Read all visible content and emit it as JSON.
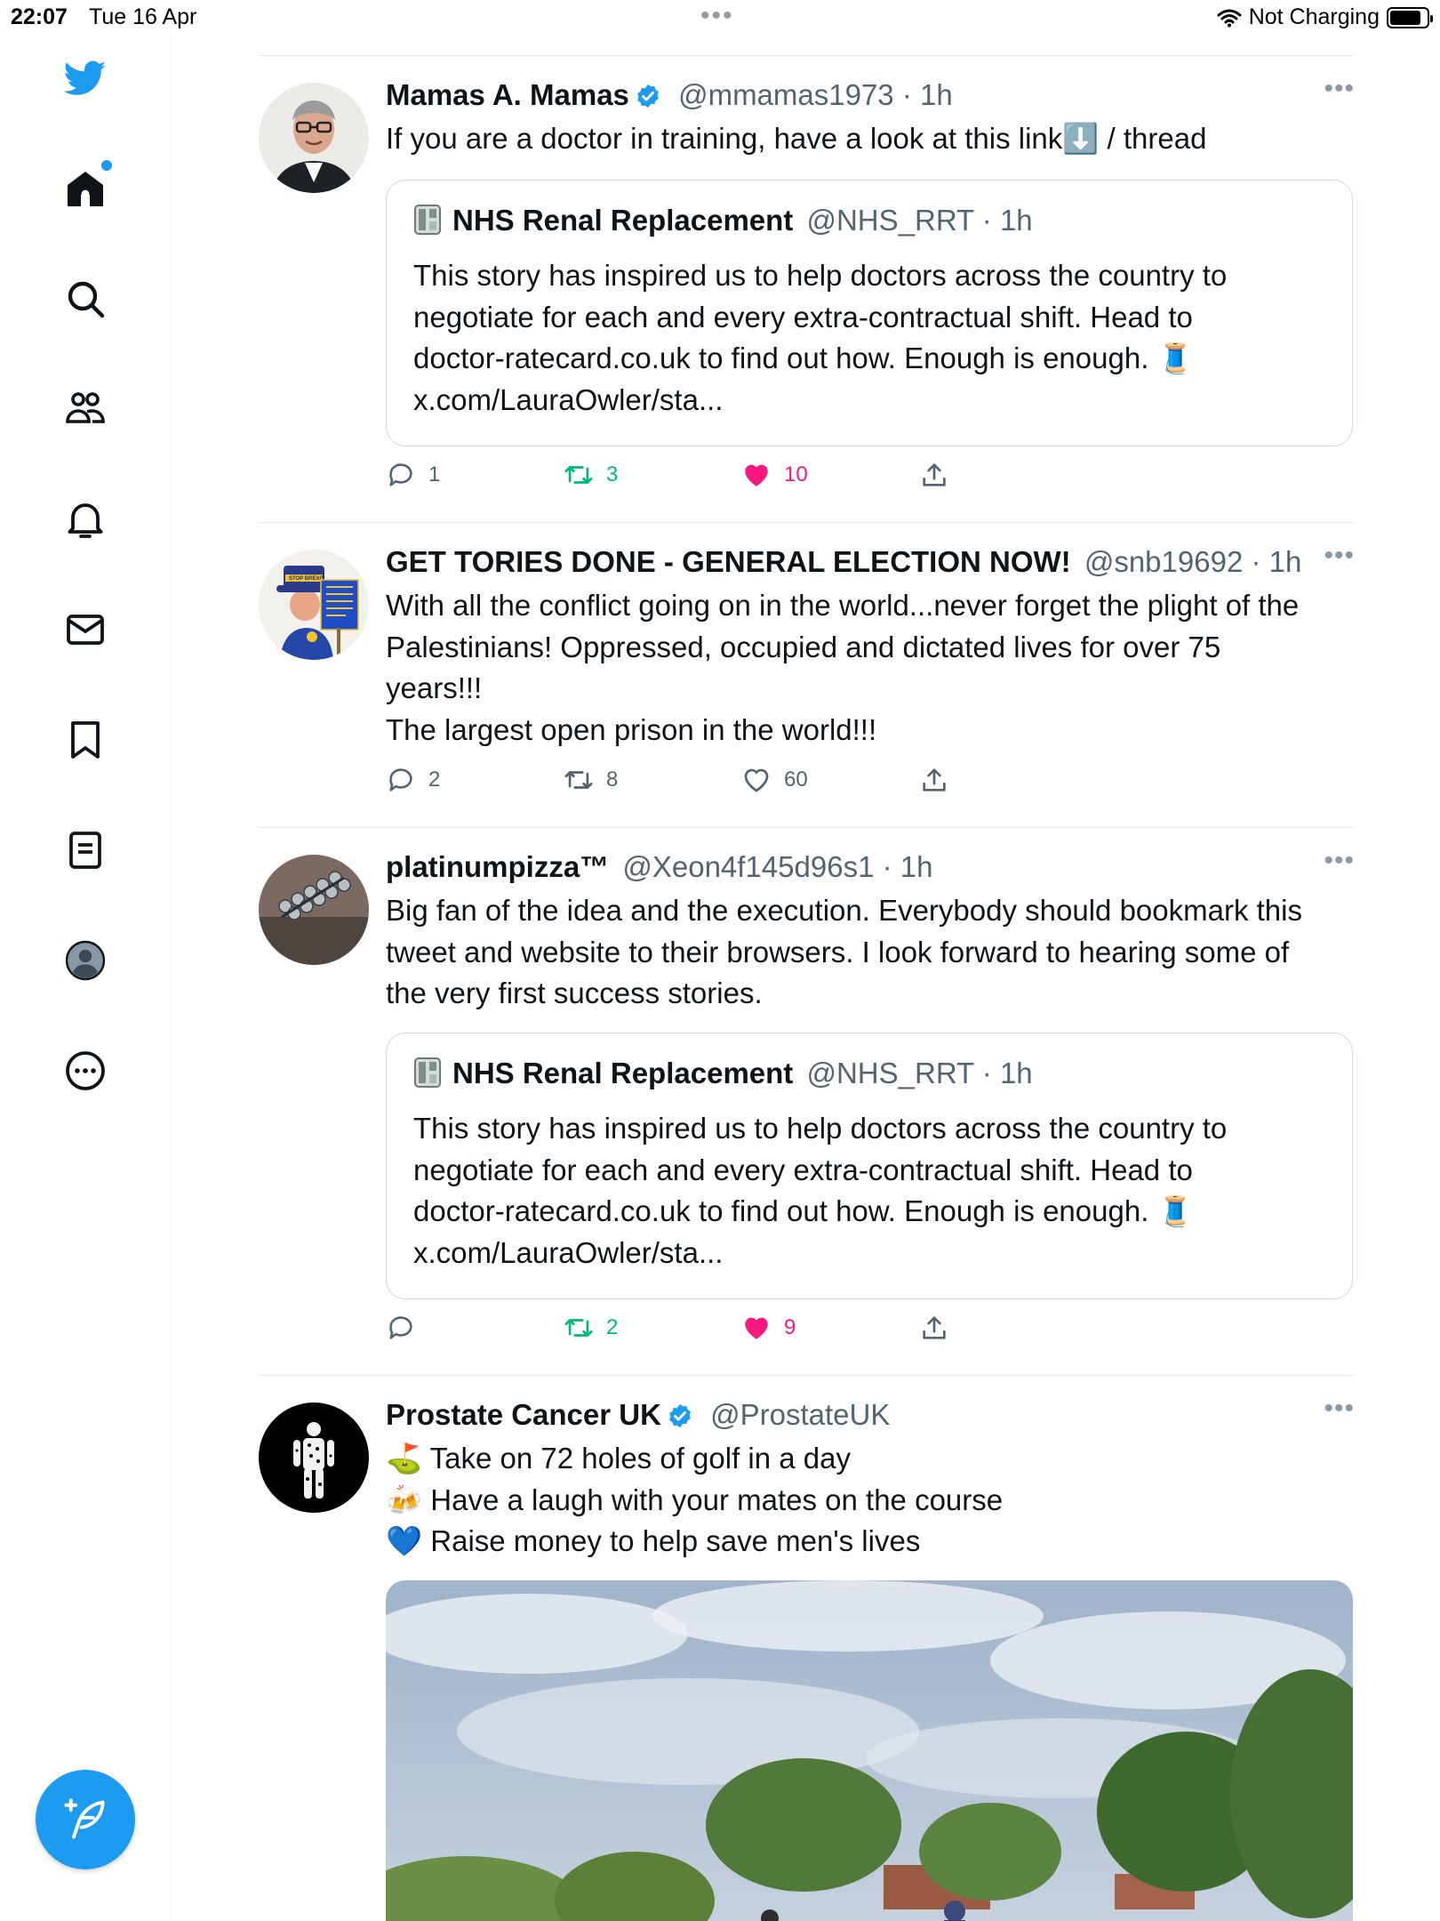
{
  "status_bar": {
    "time": "22:07",
    "date": "Tue 16 Apr",
    "battery_text": "Not Charging"
  },
  "colors": {
    "accent": "#1d9bf0",
    "retweet_active": "#00ba7c",
    "like_active": "#f91880",
    "secondary_text": "#536471"
  },
  "sidebar": {
    "items": [
      {
        "icon": "twitter-bird-icon"
      },
      {
        "icon": "home-icon",
        "notification_dot": true
      },
      {
        "icon": "search-icon"
      },
      {
        "icon": "communities-icon"
      },
      {
        "icon": "bell-icon"
      },
      {
        "icon": "mail-icon"
      },
      {
        "icon": "bookmark-icon"
      },
      {
        "icon": "lists-icon"
      },
      {
        "icon": "profile-icon"
      },
      {
        "icon": "more-circle-icon"
      }
    ],
    "compose_icon": "compose-feather-icon"
  },
  "tweets": [
    {
      "name": "Mamas A. Mamas",
      "verified": true,
      "handle": "@mmamas1973 · 1h",
      "text": "If you are a doctor in training, have a look at this link⬇️ / thread",
      "quote": {
        "name": "NHS Renal Replacement",
        "handle": "@NHS_RRT · 1h",
        "text": "This story has inspired us to help doctors across the country to\nnegotiate for each and every extra-contractual shift. Head to\ndoctor-ratecard.co.uk to find out how. Enough is enough. 🧵\nx.com/LauraOwler/sta..."
      },
      "replies": "1",
      "retweets": "3",
      "likes": "10",
      "retweeted": true,
      "liked": true
    },
    {
      "name": "GET TORIES DONE - GENERAL ELECTION NOW!",
      "verified": false,
      "handle": "@snb19692 · 1h",
      "text": "With all the conflict going on in the world...never forget the plight of the\nPalestinians! Oppressed, occupied and dictated lives for over 75\nyears!!!\nThe largest open prison in the world!!!",
      "replies": "2",
      "retweets": "8",
      "likes": "60",
      "retweeted": false,
      "liked": false
    },
    {
      "name": "platinumpizza™",
      "verified": false,
      "handle": "@Xeon4f145d96s1 · 1h",
      "text": "Big fan of the idea and the execution. Everybody should bookmark this\ntweet and website to their browsers. I look forward to hearing some of\nthe very first success stories.",
      "quote": {
        "name": "NHS Renal Replacement",
        "handle": "@NHS_RRT · 1h",
        "text": "This story has inspired us to help doctors across the country to\nnegotiate for each and every extra-contractual shift. Head to\ndoctor-ratecard.co.uk to find out how. Enough is enough. 🧵\nx.com/LauraOwler/sta..."
      },
      "replies": "",
      "retweets": "2",
      "likes": "9",
      "retweeted": true,
      "liked": true
    },
    {
      "name": "Prostate Cancer UK",
      "verified": true,
      "handle": "@ProstateUK",
      "text": "⛳ Take on 72 holes of golf in a day\n🍻 Have a laugh with your mates on the course\n💙 Raise money to help save men's lives"
    }
  ]
}
